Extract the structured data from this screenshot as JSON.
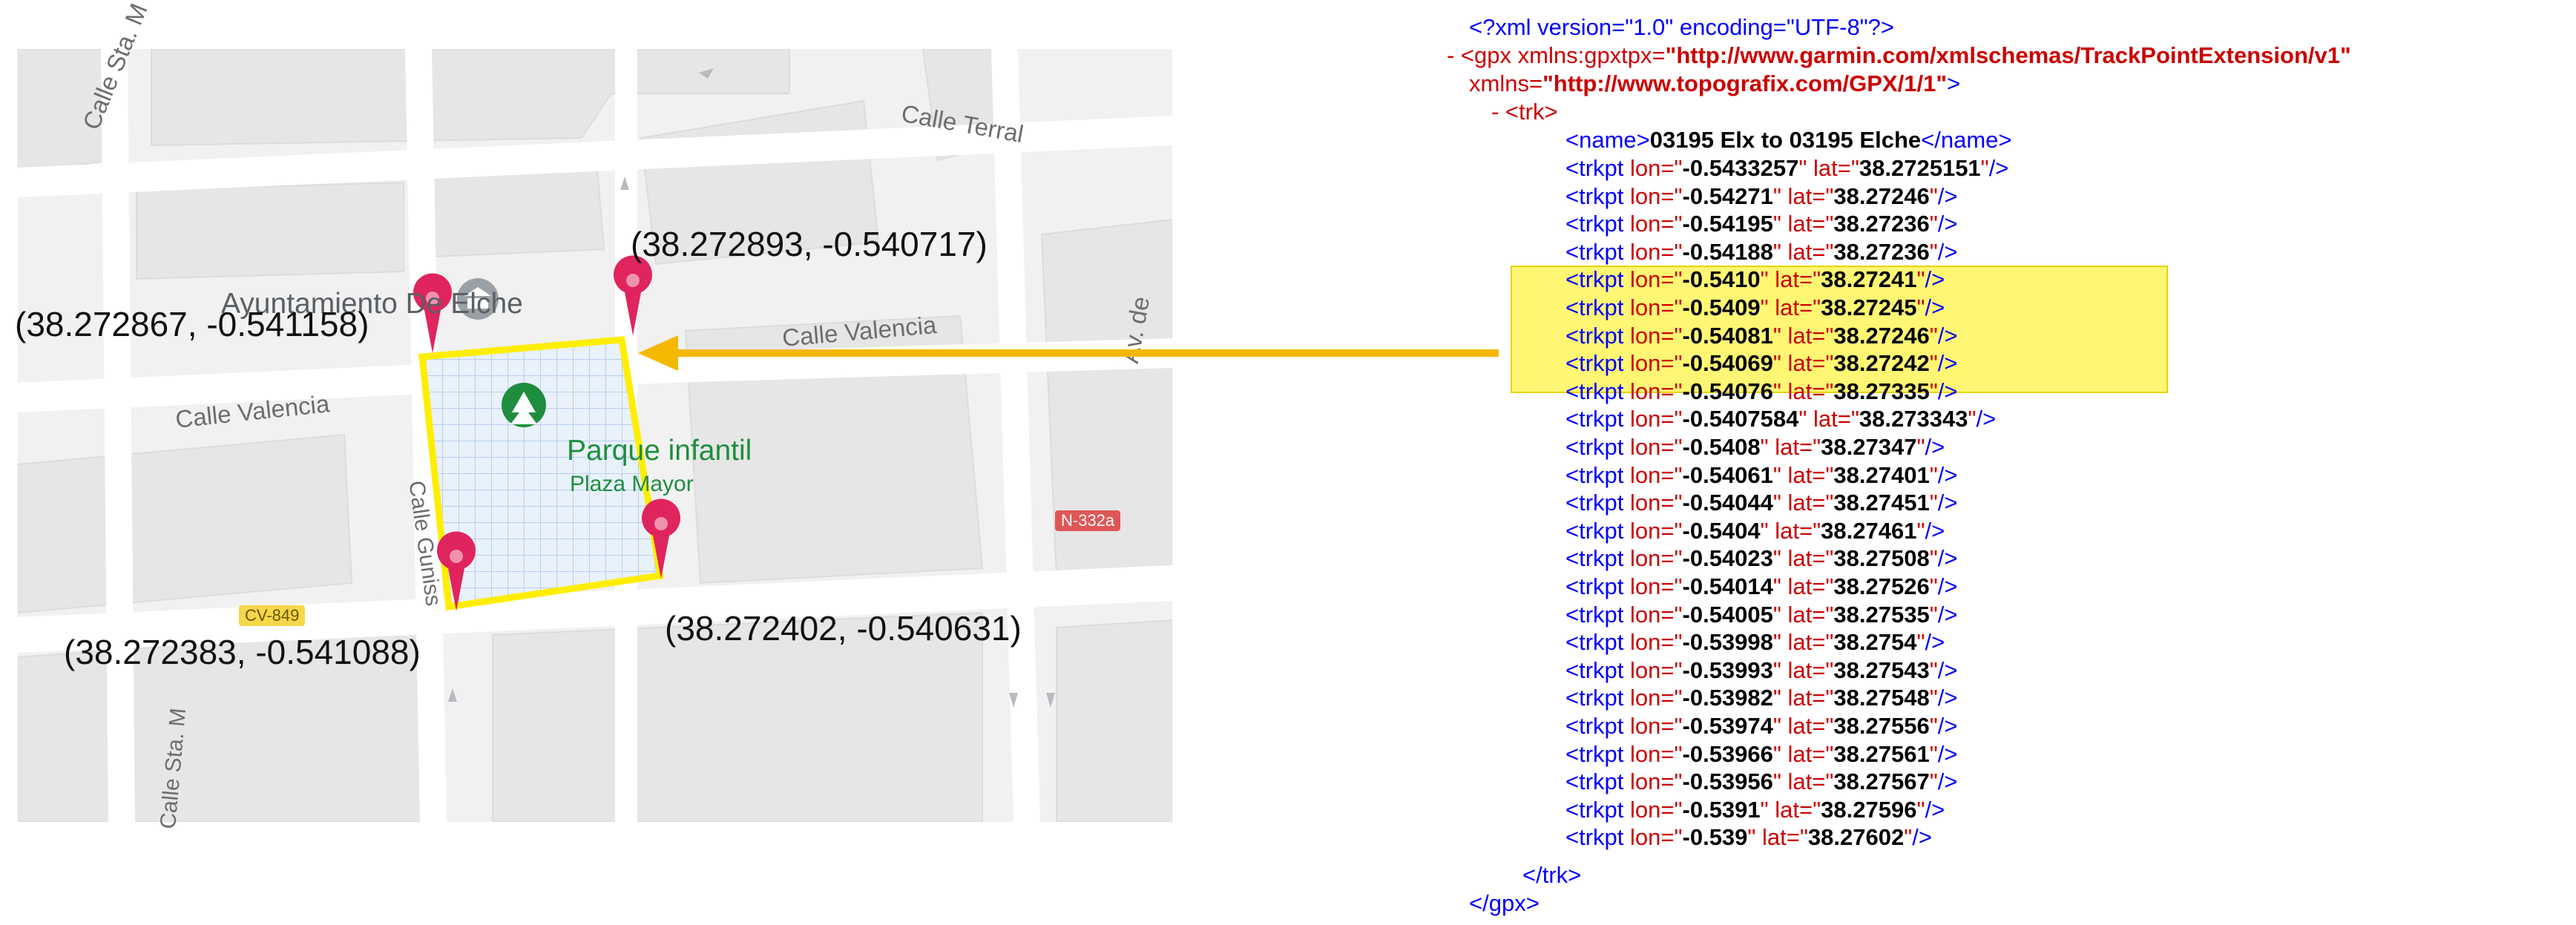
{
  "map": {
    "poi_title": "Ayuntamiento De Elche",
    "park_name": "Parque infantil",
    "park_sub": "Plaza Mayor",
    "streets": {
      "sta_ma_top": "Calle Sta. M",
      "terral": "Calle Terral",
      "valencia_right": "Calle Valencia",
      "valencia_left": "Calle Valencia",
      "av": "Av. de",
      "gunisa": "Calle Guniss",
      "sta_ma_bottom": "Calle Sta. M"
    },
    "road_badges": {
      "cv": "CV-849",
      "n": "N-332a"
    },
    "corners": {
      "top_left": "(38.272867, -0.541158)",
      "top_right": "(38.272893, -0.540717)",
      "bottom_left": "(38.272383, -0.541088)",
      "bottom_right": "(38.272402, -0.540631)"
    }
  },
  "xml": {
    "decl": "<?xml version=\"1.0\" encoding=\"UTF-8\"?>",
    "gpx_open_prefix": "- <gpx xmlns:gpxtpx=",
    "gpx_ns1": "\"http://www.garmin.com/xmlschemas/TrackPointExtension/v1\"",
    "gpx_xmlns": "xmlns=",
    "gpx_ns2": "\"http://www.topografix.com/GPX/1/1\"",
    "gpx_gt": ">",
    "trk_open": "- <trk>",
    "name_open": "<name>",
    "name_value": "03195 Elx to 03195 Elche",
    "name_close": "</name>",
    "trkpts": [
      {
        "lon": "-0.5433257",
        "lat": "38.2725151"
      },
      {
        "lon": "-0.54271",
        "lat": "38.27246"
      },
      {
        "lon": "-0.54195",
        "lat": "38.27236"
      },
      {
        "lon": "-0.54188",
        "lat": "38.27236"
      },
      {
        "lon": "-0.5410",
        "lat": "38.27241"
      },
      {
        "lon": "-0.5409",
        "lat": "38.27245"
      },
      {
        "lon": "-0.54081",
        "lat": "38.27246"
      },
      {
        "lon": "-0.54069",
        "lat": "38.27242"
      },
      {
        "lon": "-0.54076",
        "lat": "38.27335"
      },
      {
        "lon": "-0.5407584",
        "lat": "38.273343"
      },
      {
        "lon": "-0.5408",
        "lat": "38.27347"
      },
      {
        "lon": "-0.54061",
        "lat": "38.27401"
      },
      {
        "lon": "-0.54044",
        "lat": "38.27451"
      },
      {
        "lon": "-0.5404",
        "lat": "38.27461"
      },
      {
        "lon": "-0.54023",
        "lat": "38.27508"
      },
      {
        "lon": "-0.54014",
        "lat": "38.27526"
      },
      {
        "lon": "-0.54005",
        "lat": "38.27535"
      },
      {
        "lon": "-0.53998",
        "lat": "38.2754"
      },
      {
        "lon": "-0.53993",
        "lat": "38.27543"
      },
      {
        "lon": "-0.53982",
        "lat": "38.27548"
      },
      {
        "lon": "-0.53974",
        "lat": "38.27556"
      },
      {
        "lon": "-0.53966",
        "lat": "38.27561"
      },
      {
        "lon": "-0.53956",
        "lat": "38.27567"
      },
      {
        "lon": "-0.5391",
        "lat": "38.27596"
      },
      {
        "lon": "-0.539",
        "lat": "38.27602"
      }
    ],
    "trk_close": "</trk>",
    "gpx_close": "</gpx>"
  },
  "colors": {
    "highlight": "#fff200",
    "arrow": "#f5b800",
    "xml_tag": "#0000ff",
    "xml_attr": "#cc0000",
    "park_green": "#1e8e3e",
    "marker": "#e0245e"
  }
}
